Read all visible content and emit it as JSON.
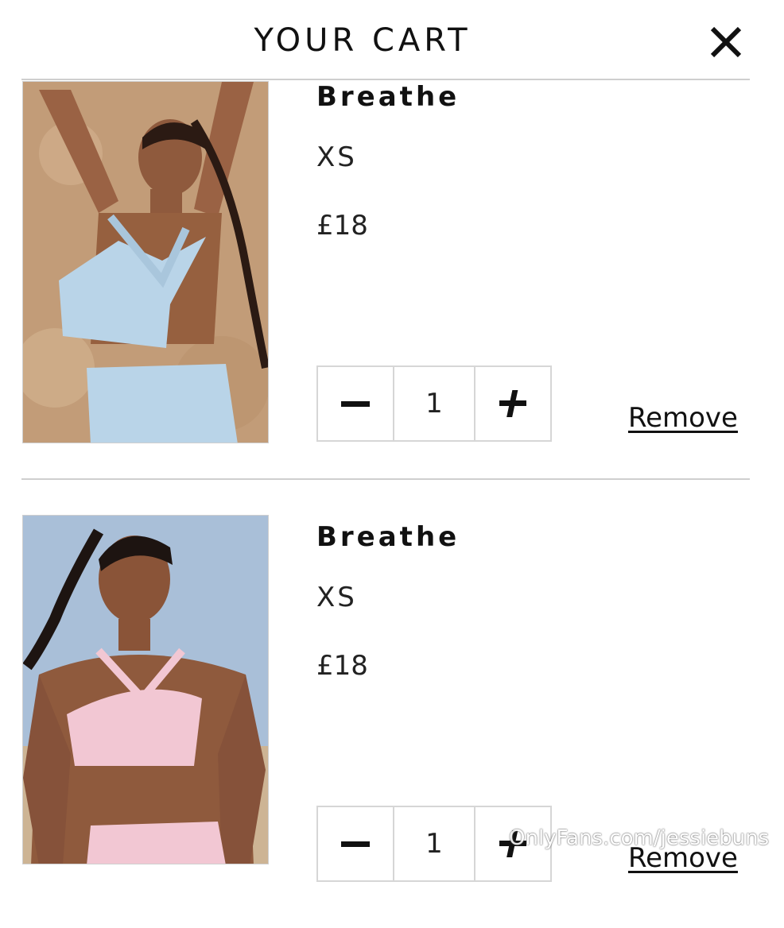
{
  "header": {
    "title": "YOUR CART",
    "close_icon": "close-icon"
  },
  "cart": {
    "items": [
      {
        "name": "Breathe",
        "size": "XS",
        "price": "£18",
        "quantity": "1",
        "remove_label": "Remove",
        "image_desc_color": "#b9d4e8"
      },
      {
        "name": "Breathe",
        "size": "XS",
        "price": "£18",
        "quantity": "1",
        "remove_label": "Remove",
        "image_desc_color": "#f2c7d3"
      }
    ],
    "decrement_icon": "minus-icon",
    "increment_icon": "plus-icon"
  },
  "watermark": "OnlyFans.com/jessiebuns"
}
